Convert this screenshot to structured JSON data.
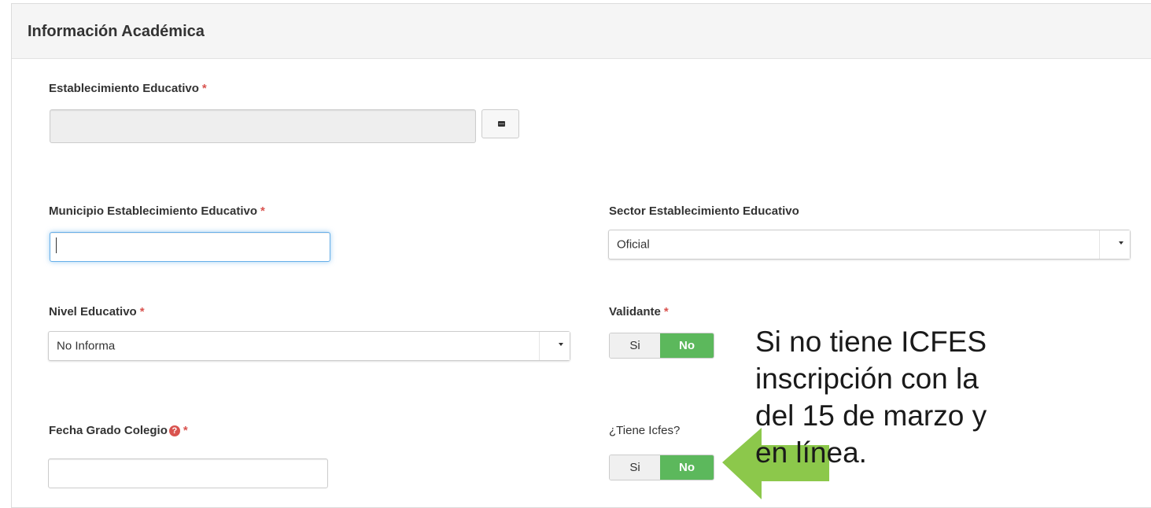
{
  "panel": {
    "title": "Información Académica"
  },
  "fields": {
    "establecimiento": {
      "label": "Establecimiento Educativo",
      "required": "*",
      "value": ""
    },
    "municipio": {
      "label": "Municipio Establecimiento Educativo",
      "required": "*",
      "value": ""
    },
    "sector": {
      "label": "Sector Establecimiento Educativo",
      "selected": "Oficial"
    },
    "nivel": {
      "label": "Nivel Educativo",
      "required": "*",
      "selected": "No Informa"
    },
    "validante": {
      "label": "Validante",
      "required": "*",
      "options": [
        "Si",
        "No"
      ],
      "selected": "No"
    },
    "fecha_grado": {
      "label": "Fecha Grado Colegio",
      "required": "*",
      "help_icon": "question-circle-icon",
      "value": ""
    },
    "tiene_icfes": {
      "label": "¿Tiene Icfes?",
      "options": [
        "Si",
        "No"
      ],
      "selected": "No"
    }
  },
  "note": {
    "lines": [
      "Si no tiene ICFES",
      "inscripción con la",
      "del 15 de marzo y",
      "en línea."
    ]
  },
  "colors": {
    "toggle_on": "#5cb85c",
    "required": "#d9534f",
    "arrow": "#8cc84b"
  }
}
